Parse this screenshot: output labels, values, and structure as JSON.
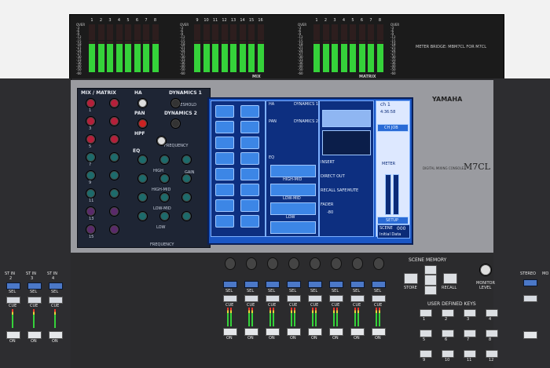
{
  "meter_bridge": {
    "mix_numbers": [
      "1",
      "2",
      "3",
      "4",
      "5",
      "6",
      "7",
      "8",
      "9",
      "10",
      "11",
      "12",
      "13",
      "14",
      "15",
      "16"
    ],
    "matrix_numbers": [
      "1",
      "2",
      "3",
      "4",
      "5",
      "6",
      "7",
      "8"
    ],
    "scale": [
      "OVER",
      "-3",
      "-6",
      "-9",
      "-12",
      "-15",
      "-18",
      "-21",
      "-24",
      "-27",
      "-30",
      "-33",
      "-36",
      "-40",
      "-50",
      "-60"
    ],
    "mix_label": "MIX",
    "matrix_label": "MATRIX",
    "note": "METER BRIDGE: MBM7CL FOR M7CL"
  },
  "brand": {
    "name": "YAMAHA",
    "subtitle": "DIGITAL MIXING CONSOLE",
    "model": "M7CL"
  },
  "selector": {
    "mix_matrix": "MIX / MATRIX",
    "ha": "HA",
    "dynamics1": "DYNAMICS 1",
    "pan": "PAN",
    "dynamics2": "DYNAMICS 2",
    "hpf": "HPF",
    "eq": "EQ",
    "frequency": "FREQUENCY",
    "gain": "GAIN",
    "high": "HIGH",
    "high_mid": "HIGH-MID",
    "low_mid": "LOW-MID",
    "low": "LOW",
    "threshold": "THRESHOLD",
    "row_numbers": [
      "1",
      "3",
      "5",
      "7",
      "9",
      "11",
      "13",
      "15"
    ]
  },
  "lcd": {
    "ha": "HA",
    "dynamics1": "DYNAMICS 1",
    "dynamics2": "DYNAMICS 2",
    "pan": "PAN",
    "eq": "EQ",
    "high_mid": "HIGH-MID",
    "low_mid": "LOW-MID",
    "low": "LOW",
    "insert": "INSERT",
    "direct_out": "DIRECT OUT",
    "recall_safe": "RECALL SAFE",
    "mute": "MUTE",
    "fader": "FADER",
    "meter": "METER",
    "ch_label": "ch 1",
    "time": "4:36:58",
    "scene_label": "SCENE",
    "scene_num": "000",
    "scene_name": "Initial Data",
    "ch_job": "CH JOB",
    "setup": "SETUP",
    "value": "-80"
  },
  "fader_channels": {
    "sel": "SEL",
    "cue": "CUE",
    "on": "ON",
    "count": 8
  },
  "st_in": {
    "label": "ST IN",
    "numbers": [
      "2",
      "3",
      "4"
    ]
  },
  "stereo": {
    "label": "STEREO",
    "mono": "MO"
  },
  "scene_memory": {
    "title": "SCENE MEMORY",
    "store": "STORE",
    "recall": "RECALL",
    "monitor": "MONITOR",
    "level": "LEVEL"
  },
  "user_keys": {
    "title": "USER DEFINED KEYS",
    "numbers": [
      "1",
      "2",
      "3",
      "4",
      "5",
      "6",
      "7",
      "8",
      "9",
      "10",
      "11",
      "12"
    ]
  },
  "colors": {
    "lcd_bg": "#1a56c4",
    "meter_green": "#35d23a",
    "meter_yellow": "#e8d33a",
    "meter_red": "#e83a2e",
    "sel_blue": "#4b78c8"
  }
}
